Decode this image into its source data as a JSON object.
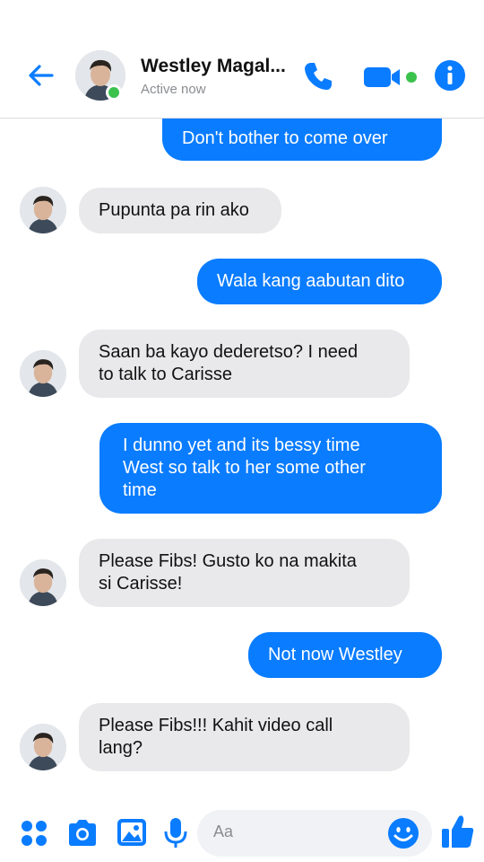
{
  "header": {
    "contact_name": "Westley Magal...",
    "status": "Active now"
  },
  "messages": [
    {
      "direction": "out",
      "text": "Don't  bother  to come over"
    },
    {
      "direction": "in",
      "text": "Pupunta pa rin ako"
    },
    {
      "direction": "out",
      "text": "Wala kang aabutan dito"
    },
    {
      "direction": "in",
      "line1": "Saan ba kayo dederetso? I need",
      "line2": "to talk to Carisse"
    },
    {
      "direction": "out",
      "line1": "I dunno yet and its bessy time",
      "line2": "West so talk to her some other",
      "line3": "time"
    },
    {
      "direction": "in",
      "line1": "Please Fibs! Gusto ko na makita",
      "line2": "si Carisse!"
    },
    {
      "direction": "out",
      "text": "Not now Westley"
    },
    {
      "direction": "in",
      "line1": "Please Fibs!!! Kahit video call",
      "line2": "lang?"
    }
  ],
  "composer": {
    "placeholder": "Aa"
  },
  "colors": {
    "accent": "#0a7cff",
    "incoming_bubble": "#e9e9eb",
    "online": "#3ac24d"
  },
  "icons": [
    "back-arrow-icon",
    "phone-icon",
    "video-camera-icon",
    "info-icon",
    "apps-grid-icon",
    "camera-icon",
    "image-icon",
    "microphone-icon",
    "emoji-icon",
    "thumbs-up-icon"
  ]
}
